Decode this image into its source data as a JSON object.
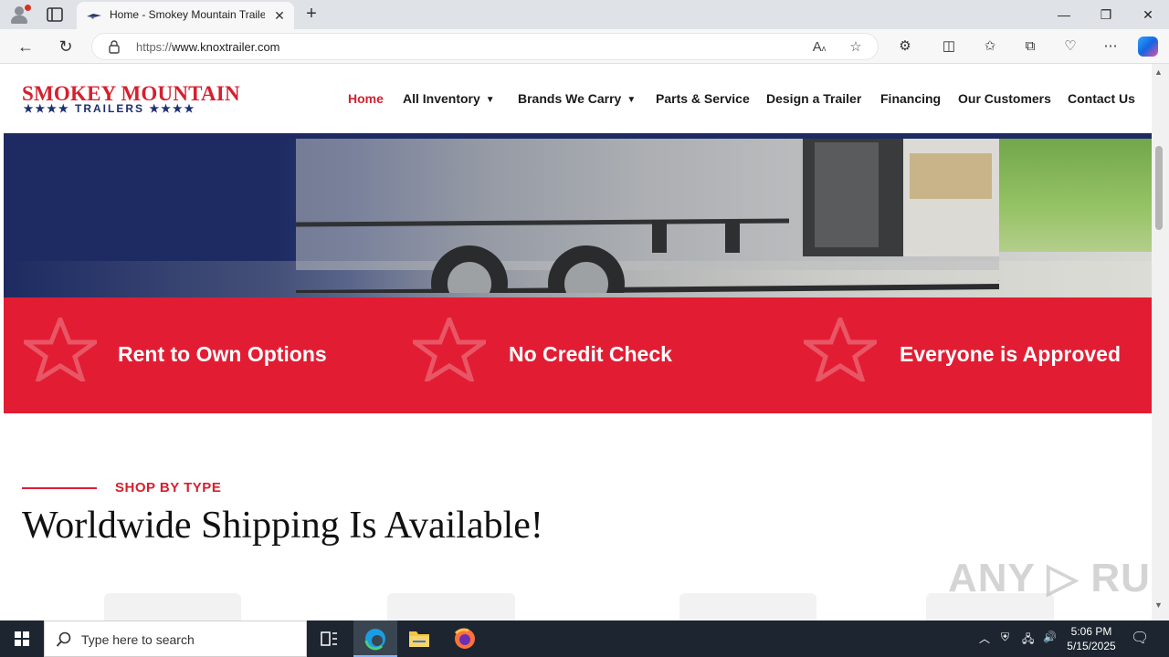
{
  "browser": {
    "tab_title": "Home - Smokey Mountain Trailers",
    "url_protocol": "https://",
    "url_host": "www.knoxtrailer.com"
  },
  "site": {
    "logo_line1": "SMOKEY MOUNTAIN",
    "logo_line2": "★★★★ TRAILERS ★★★★",
    "nav": [
      {
        "label": "Home"
      },
      {
        "label": "All Inventory"
      },
      {
        "label": "Brands We Carry"
      },
      {
        "label": "Parts & Service"
      },
      {
        "label": "Design a Trailer"
      },
      {
        "label": "Financing"
      },
      {
        "label": "Our Customers"
      },
      {
        "label": "Contact Us"
      }
    ],
    "features": [
      {
        "label": "Rent to Own Options"
      },
      {
        "label": "No Credit Check"
      },
      {
        "label": "Everyone is Approved"
      }
    ],
    "eyebrow": "SHOP BY TYPE",
    "heading": "Worldwide Shipping Is Available!",
    "watermark": "ANY ▷ RUN"
  },
  "taskbar": {
    "search_placeholder": "Type here to search",
    "time": "5:06 PM",
    "date": "5/15/2025"
  },
  "colors": {
    "brand_red": "#e21d33",
    "brand_navy": "#1d2b62",
    "active_nav": "#d5202e"
  }
}
